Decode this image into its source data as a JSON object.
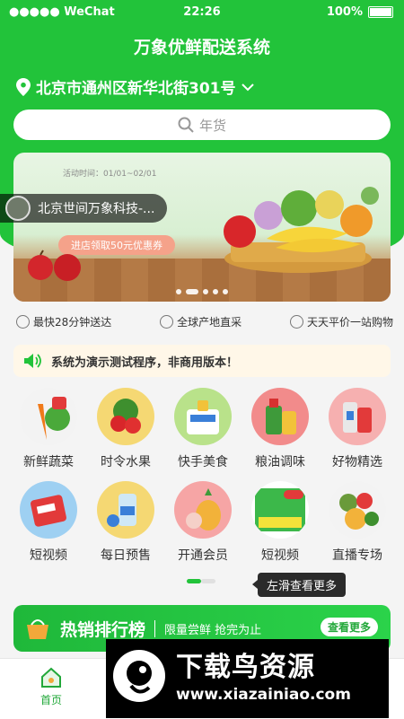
{
  "status_bar": {
    "carrier": "●●●●● WeChat",
    "time": "22:26",
    "battery": "100%"
  },
  "app_title": "万象优鲜配送系统",
  "location": "北京市通州区新华北街301号",
  "search": {
    "placeholder": "年货"
  },
  "banner": {
    "activity_time": "活动时间：01/01~02/01",
    "shop_name": "北京世间万象科技-...",
    "coupon": "进店领取50元优惠券",
    "dots": 5,
    "active_dot": 1
  },
  "features": [
    {
      "label": "最快28分钟送达",
      "icon": "clock-icon"
    },
    {
      "label": "全球产地直采",
      "icon": "globe-icon"
    },
    {
      "label": "天天平价一站购物",
      "icon": "shield-icon"
    }
  ],
  "notice": "系统为演示测试程序，非商用版本！",
  "categories": [
    {
      "label": "新鲜蔬菜",
      "color": "#f3f3f3",
      "icon": "vegetables-icon"
    },
    {
      "label": "时令水果",
      "color": "#f5d873",
      "icon": "fruit-icon"
    },
    {
      "label": "快手美食",
      "color": "#b9e28a",
      "icon": "food-icon"
    },
    {
      "label": "粮油调味",
      "color": "#f28b8b",
      "icon": "oil-icon"
    },
    {
      "label": "好物精选",
      "color": "#f6b0b0",
      "icon": "goods-icon"
    },
    {
      "label": "短视频",
      "color": "#9ed0f2",
      "icon": "video-icon"
    },
    {
      "label": "每日预售",
      "color": "#f5d873",
      "icon": "presale-icon"
    },
    {
      "label": "开通会员",
      "color": "#f6a5a5",
      "icon": "member-icon"
    },
    {
      "label": "短视频",
      "color": "#ffffff",
      "icon": "video-promo-icon"
    },
    {
      "label": "直播专场",
      "color": "#f3f3f3",
      "icon": "live-icon"
    }
  ],
  "swipe_tip": "左滑查看更多",
  "hot_sales": {
    "title": "热销排行榜",
    "subtitle": "限量尝鲜 抢完为止",
    "more": "查看更多"
  },
  "tabbar": {
    "home": "首页"
  },
  "watermark": {
    "text": "下载鸟资源",
    "url": "www.xiazainiao.com"
  }
}
